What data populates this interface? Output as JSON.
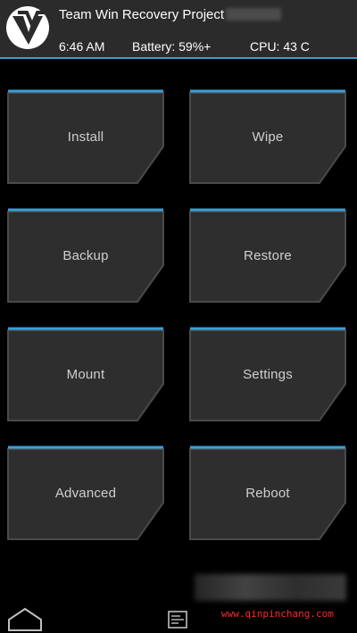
{
  "header": {
    "title": "Team Win Recovery Project",
    "time": "6:46 AM",
    "battery": "Battery: 59%+",
    "cpu": "CPU: 43 C"
  },
  "buttons": {
    "install": "Install",
    "wipe": "Wipe",
    "backup": "Backup",
    "restore": "Restore",
    "mount": "Mount",
    "settings": "Settings",
    "advanced": "Advanced",
    "reboot": "Reboot"
  },
  "footer": {
    "watermark": "www.qinpinchang.com"
  },
  "icons": {
    "logo": "twrp-logo-icon",
    "home": "home-icon",
    "console": "console-icon"
  },
  "colors": {
    "accent": "#3aa0d8",
    "header_bg": "#2b2b2b",
    "button_bg": "#2e2e2e",
    "button_label": "#cfcfcf",
    "background": "#000000",
    "watermark": "#ff2a2a"
  }
}
